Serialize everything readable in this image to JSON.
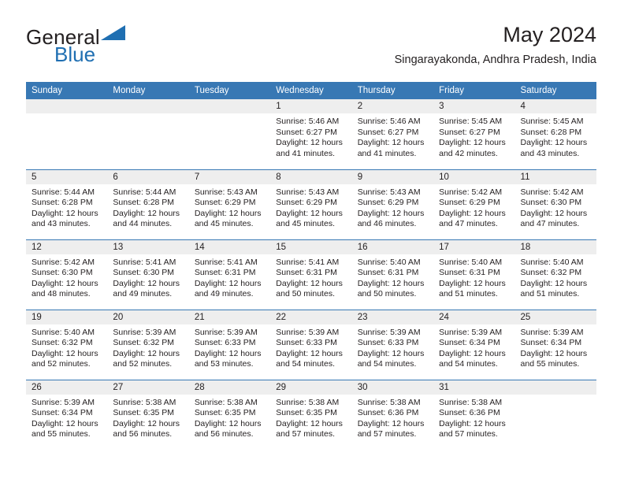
{
  "brand": {
    "name_part1": "General",
    "name_part2": "Blue",
    "triangle_icon": "triangle-icon",
    "accent_color": "#1f6fb2"
  },
  "header": {
    "title": "May 2024",
    "subtitle": "Singarayakonda, Andhra Pradesh, India"
  },
  "colors": {
    "header_bar": "#3878b4",
    "date_band": "#eeeeee",
    "text": "#231f20",
    "row_divider": "#3878b4"
  },
  "weekday_headers": [
    "Sunday",
    "Monday",
    "Tuesday",
    "Wednesday",
    "Thursday",
    "Friday",
    "Saturday"
  ],
  "labels": {
    "sunrise_prefix": "Sunrise:",
    "sunset_prefix": "Sunset:",
    "daylight_prefix": "Daylight:"
  },
  "weeks": [
    [
      {
        "day": "",
        "lines": []
      },
      {
        "day": "",
        "lines": []
      },
      {
        "day": "",
        "lines": []
      },
      {
        "day": "1",
        "lines": [
          "Sunrise: 5:46 AM",
          "Sunset: 6:27 PM",
          "Daylight: 12 hours",
          "and 41 minutes."
        ]
      },
      {
        "day": "2",
        "lines": [
          "Sunrise: 5:46 AM",
          "Sunset: 6:27 PM",
          "Daylight: 12 hours",
          "and 41 minutes."
        ]
      },
      {
        "day": "3",
        "lines": [
          "Sunrise: 5:45 AM",
          "Sunset: 6:27 PM",
          "Daylight: 12 hours",
          "and 42 minutes."
        ]
      },
      {
        "day": "4",
        "lines": [
          "Sunrise: 5:45 AM",
          "Sunset: 6:28 PM",
          "Daylight: 12 hours",
          "and 43 minutes."
        ]
      }
    ],
    [
      {
        "day": "5",
        "lines": [
          "Sunrise: 5:44 AM",
          "Sunset: 6:28 PM",
          "Daylight: 12 hours",
          "and 43 minutes."
        ]
      },
      {
        "day": "6",
        "lines": [
          "Sunrise: 5:44 AM",
          "Sunset: 6:28 PM",
          "Daylight: 12 hours",
          "and 44 minutes."
        ]
      },
      {
        "day": "7",
        "lines": [
          "Sunrise: 5:43 AM",
          "Sunset: 6:29 PM",
          "Daylight: 12 hours",
          "and 45 minutes."
        ]
      },
      {
        "day": "8",
        "lines": [
          "Sunrise: 5:43 AM",
          "Sunset: 6:29 PM",
          "Daylight: 12 hours",
          "and 45 minutes."
        ]
      },
      {
        "day": "9",
        "lines": [
          "Sunrise: 5:43 AM",
          "Sunset: 6:29 PM",
          "Daylight: 12 hours",
          "and 46 minutes."
        ]
      },
      {
        "day": "10",
        "lines": [
          "Sunrise: 5:42 AM",
          "Sunset: 6:29 PM",
          "Daylight: 12 hours",
          "and 47 minutes."
        ]
      },
      {
        "day": "11",
        "lines": [
          "Sunrise: 5:42 AM",
          "Sunset: 6:30 PM",
          "Daylight: 12 hours",
          "and 47 minutes."
        ]
      }
    ],
    [
      {
        "day": "12",
        "lines": [
          "Sunrise: 5:42 AM",
          "Sunset: 6:30 PM",
          "Daylight: 12 hours",
          "and 48 minutes."
        ]
      },
      {
        "day": "13",
        "lines": [
          "Sunrise: 5:41 AM",
          "Sunset: 6:30 PM",
          "Daylight: 12 hours",
          "and 49 minutes."
        ]
      },
      {
        "day": "14",
        "lines": [
          "Sunrise: 5:41 AM",
          "Sunset: 6:31 PM",
          "Daylight: 12 hours",
          "and 49 minutes."
        ]
      },
      {
        "day": "15",
        "lines": [
          "Sunrise: 5:41 AM",
          "Sunset: 6:31 PM",
          "Daylight: 12 hours",
          "and 50 minutes."
        ]
      },
      {
        "day": "16",
        "lines": [
          "Sunrise: 5:40 AM",
          "Sunset: 6:31 PM",
          "Daylight: 12 hours",
          "and 50 minutes."
        ]
      },
      {
        "day": "17",
        "lines": [
          "Sunrise: 5:40 AM",
          "Sunset: 6:31 PM",
          "Daylight: 12 hours",
          "and 51 minutes."
        ]
      },
      {
        "day": "18",
        "lines": [
          "Sunrise: 5:40 AM",
          "Sunset: 6:32 PM",
          "Daylight: 12 hours",
          "and 51 minutes."
        ]
      }
    ],
    [
      {
        "day": "19",
        "lines": [
          "Sunrise: 5:40 AM",
          "Sunset: 6:32 PM",
          "Daylight: 12 hours",
          "and 52 minutes."
        ]
      },
      {
        "day": "20",
        "lines": [
          "Sunrise: 5:39 AM",
          "Sunset: 6:32 PM",
          "Daylight: 12 hours",
          "and 52 minutes."
        ]
      },
      {
        "day": "21",
        "lines": [
          "Sunrise: 5:39 AM",
          "Sunset: 6:33 PM",
          "Daylight: 12 hours",
          "and 53 minutes."
        ]
      },
      {
        "day": "22",
        "lines": [
          "Sunrise: 5:39 AM",
          "Sunset: 6:33 PM",
          "Daylight: 12 hours",
          "and 54 minutes."
        ]
      },
      {
        "day": "23",
        "lines": [
          "Sunrise: 5:39 AM",
          "Sunset: 6:33 PM",
          "Daylight: 12 hours",
          "and 54 minutes."
        ]
      },
      {
        "day": "24",
        "lines": [
          "Sunrise: 5:39 AM",
          "Sunset: 6:34 PM",
          "Daylight: 12 hours",
          "and 54 minutes."
        ]
      },
      {
        "day": "25",
        "lines": [
          "Sunrise: 5:39 AM",
          "Sunset: 6:34 PM",
          "Daylight: 12 hours",
          "and 55 minutes."
        ]
      }
    ],
    [
      {
        "day": "26",
        "lines": [
          "Sunrise: 5:39 AM",
          "Sunset: 6:34 PM",
          "Daylight: 12 hours",
          "and 55 minutes."
        ]
      },
      {
        "day": "27",
        "lines": [
          "Sunrise: 5:38 AM",
          "Sunset: 6:35 PM",
          "Daylight: 12 hours",
          "and 56 minutes."
        ]
      },
      {
        "day": "28",
        "lines": [
          "Sunrise: 5:38 AM",
          "Sunset: 6:35 PM",
          "Daylight: 12 hours",
          "and 56 minutes."
        ]
      },
      {
        "day": "29",
        "lines": [
          "Sunrise: 5:38 AM",
          "Sunset: 6:35 PM",
          "Daylight: 12 hours",
          "and 57 minutes."
        ]
      },
      {
        "day": "30",
        "lines": [
          "Sunrise: 5:38 AM",
          "Sunset: 6:36 PM",
          "Daylight: 12 hours",
          "and 57 minutes."
        ]
      },
      {
        "day": "31",
        "lines": [
          "Sunrise: 5:38 AM",
          "Sunset: 6:36 PM",
          "Daylight: 12 hours",
          "and 57 minutes."
        ]
      },
      {
        "day": "",
        "lines": []
      }
    ]
  ]
}
